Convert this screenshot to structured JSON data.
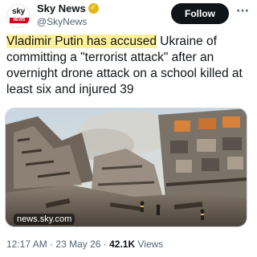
{
  "account": {
    "avatar_top": "sky",
    "avatar_bottom": "NEWS",
    "name": "Sky News",
    "verified_icon": "gold-verified-badge-icon",
    "handle": "@SkyNews"
  },
  "actions": {
    "follow_label": "Follow",
    "more_label": "···"
  },
  "tweet": {
    "text_highlight": "Vladimir Putin has accused",
    "text_rest": " Ukraine of committing a \"terrorist attack\" after an overnight drone attack on a school killed at least six and injured 39"
  },
  "media": {
    "domain": "news.sky.com",
    "image_subject": "rubble-of-destroyed-building"
  },
  "meta": {
    "time": "12:17 AM",
    "sep1": "·",
    "date": "23 May 26",
    "sep2": "·",
    "views_count": "42.1K",
    "views_label": "Views"
  },
  "colors": {
    "accent": "#0f1419",
    "muted": "#536471",
    "highlight": "#fff19a",
    "badge": "#e2b719",
    "brand_red": "#d0021b"
  }
}
